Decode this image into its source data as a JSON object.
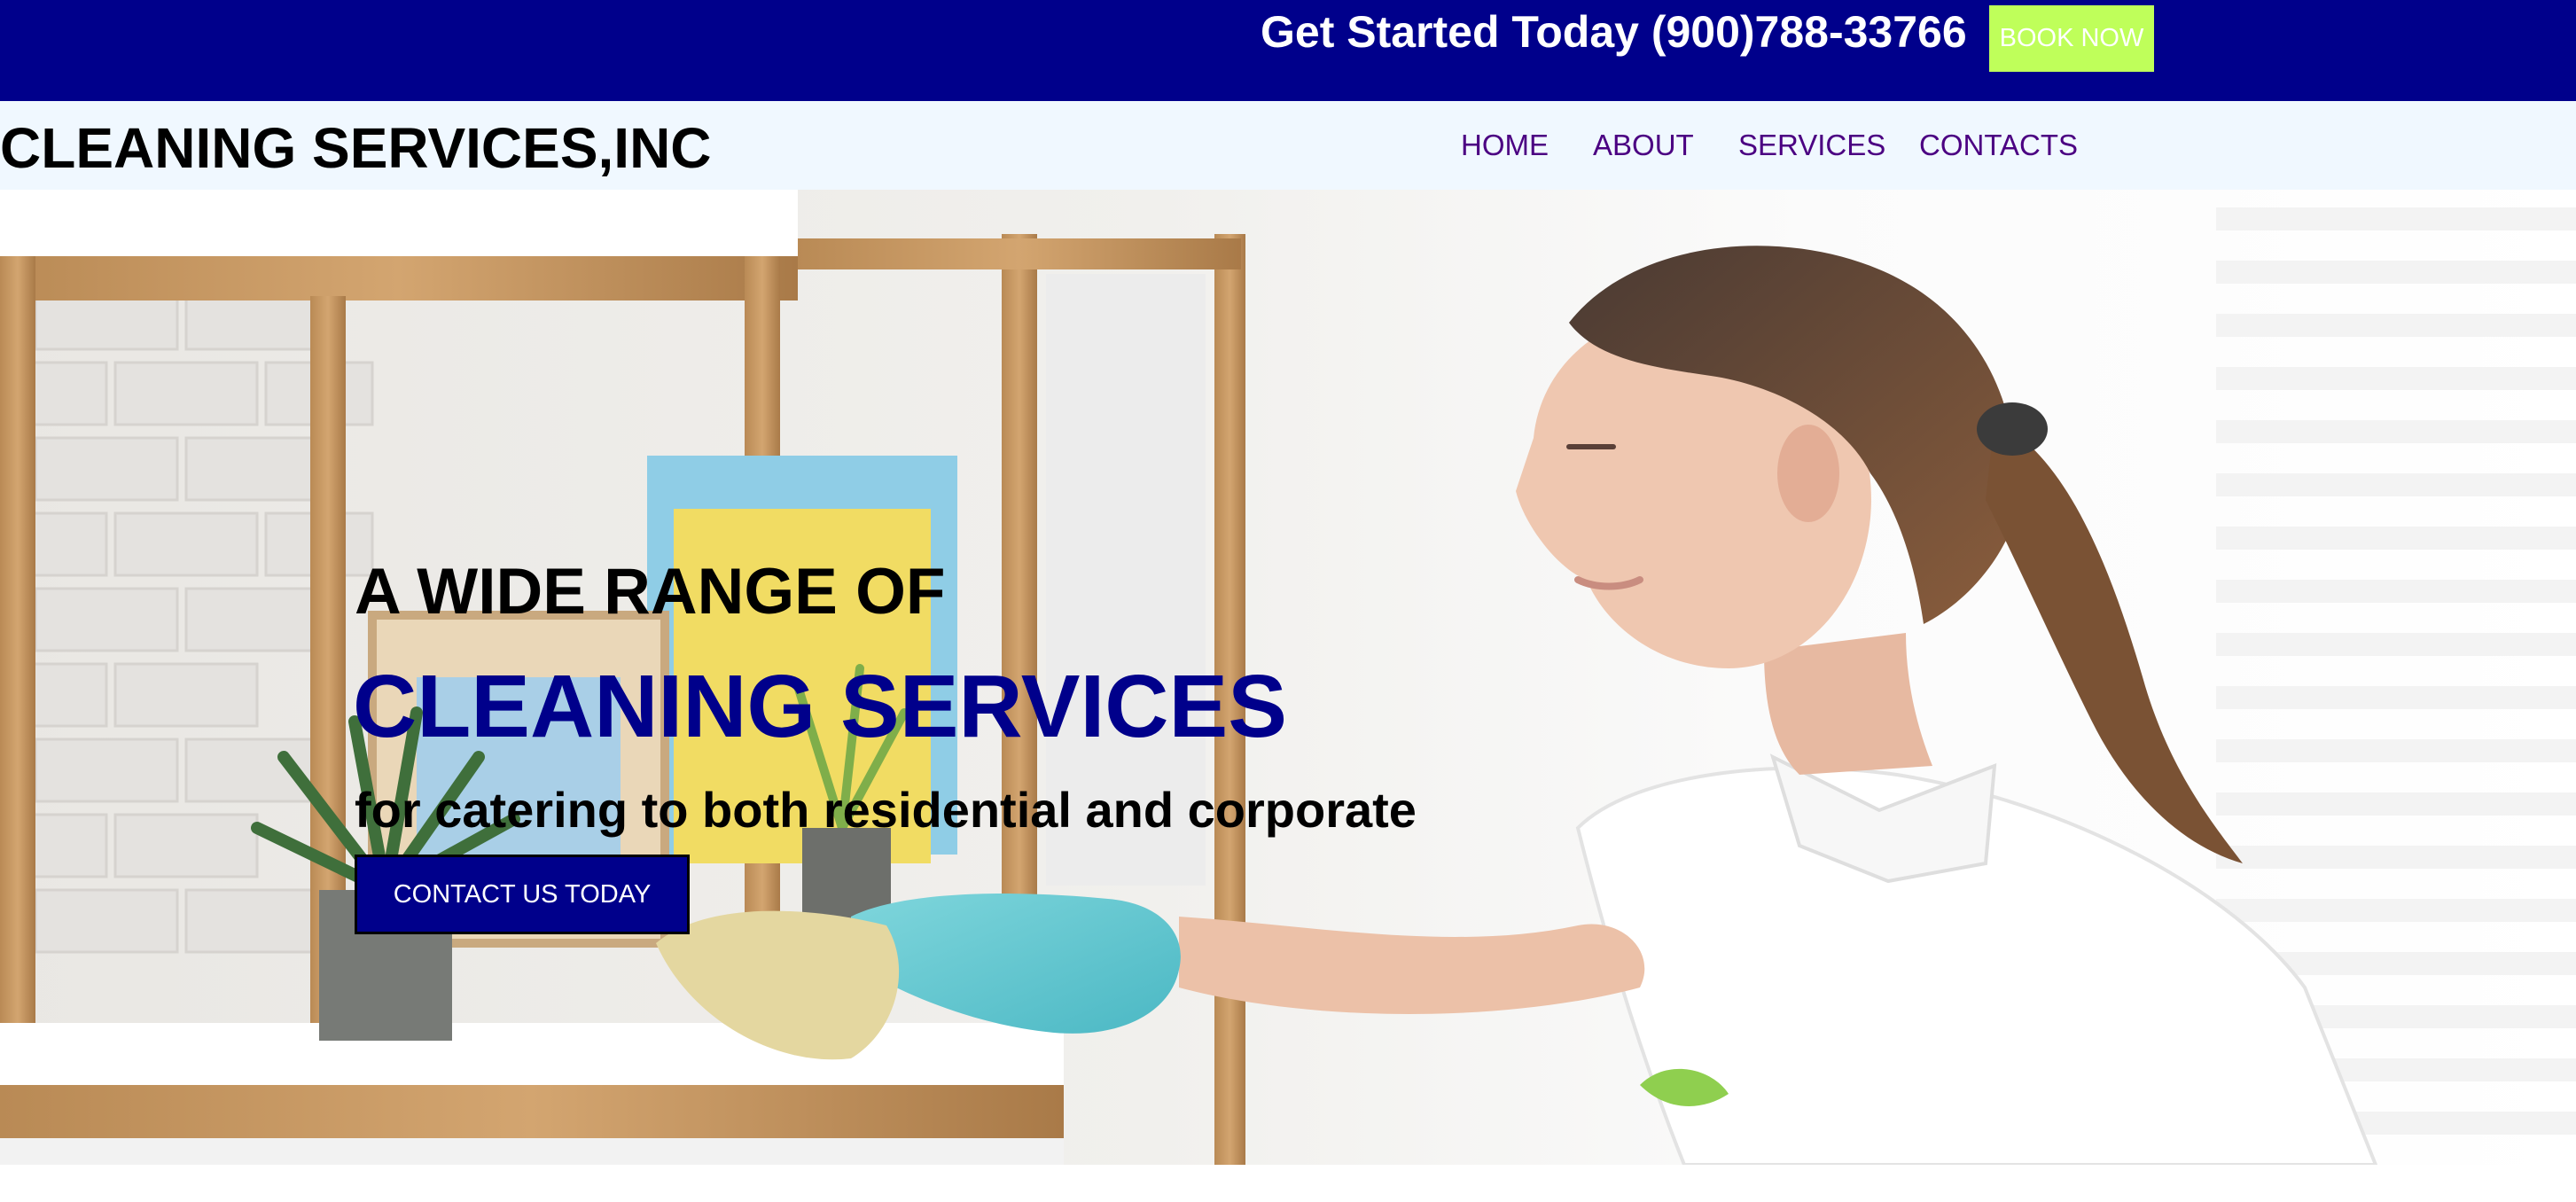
{
  "topbar": {
    "cta_text": "Get Started Today (900)788-33766",
    "book_label": "BOOK NOW"
  },
  "header": {
    "logo": "CLEANING SERVICES,INC",
    "nav": [
      {
        "label": "HOME"
      },
      {
        "label": "ABOUT"
      },
      {
        "label": "SERVICES"
      },
      {
        "label": "CONTACTS"
      }
    ]
  },
  "hero": {
    "line1": "A WIDE RANGE OF",
    "line2": "CLEANING SERVICES",
    "line3": "for catering to both residential and corporate",
    "button_label": "CONTACT US TODAY"
  },
  "colors": {
    "topbar_bg": "#00008b",
    "book_button_bg": "#bfff5a",
    "navbar_bg": "#f0f8ff",
    "nav_text": "#4b0082",
    "accent": "#00008b"
  }
}
